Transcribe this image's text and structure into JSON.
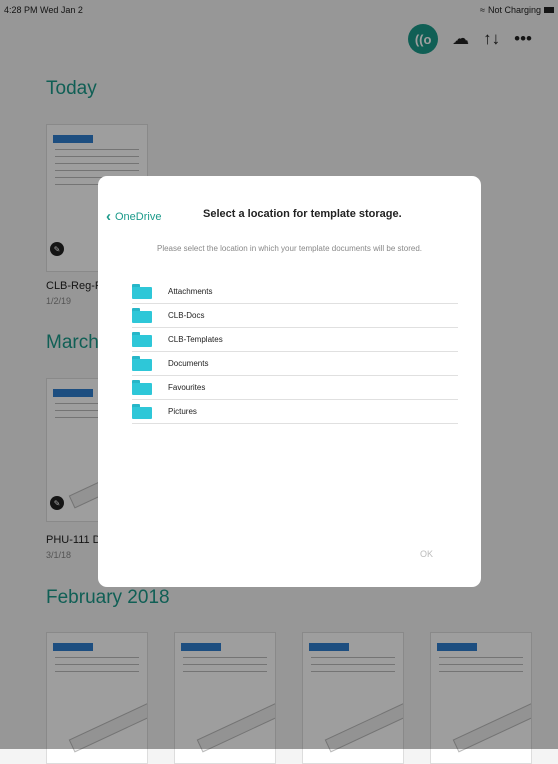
{
  "status_bar": {
    "time": "4:28 PM",
    "date": "Wed Jan 2",
    "charging": "Not Charging",
    "wifi_icon": "wifi-icon"
  },
  "toolbar": {
    "live_label": "((o",
    "sync_icon": "☁",
    "transfer_icon": "↑↓",
    "more_icon": "•••"
  },
  "sections": {
    "today": "Today",
    "march": "March",
    "february": "February 2018"
  },
  "documents": {
    "clb_name": "CLB-Reg-F",
    "clb_date": "1/2/19",
    "phu_name": "PHU-111 D",
    "phu_date": "3/1/18"
  },
  "modal": {
    "back_label": "OneDrive",
    "title": "Select a location for template storage.",
    "subtitle": "Please select the location in which your template documents will be stored.",
    "folders": [
      {
        "label": "Attachments"
      },
      {
        "label": "CLB-Docs"
      },
      {
        "label": "CLB-Templates"
      },
      {
        "label": "Documents"
      },
      {
        "label": "Favourites"
      },
      {
        "label": "Pictures"
      }
    ],
    "ok_label": "OK"
  },
  "colors": {
    "accent": "#1b9a8a",
    "folder": "#2ec7d8"
  }
}
